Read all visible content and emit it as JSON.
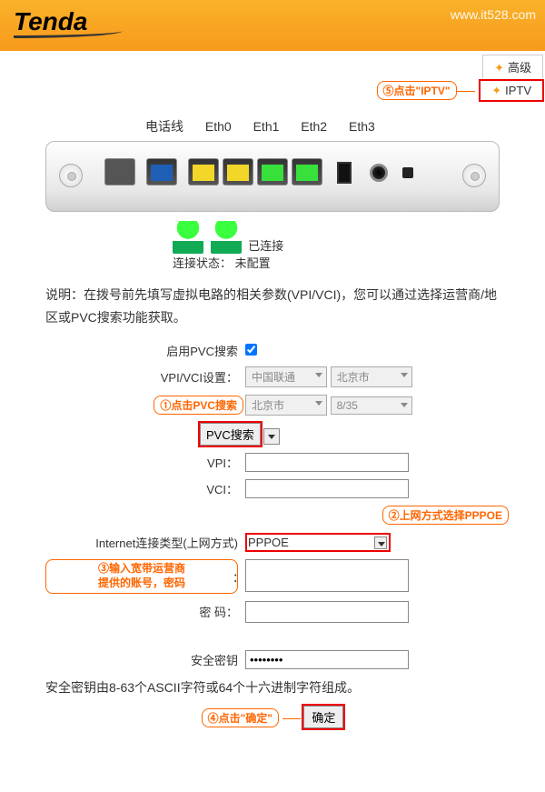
{
  "logo_text": "Tenda",
  "watermark": "www.it528.com",
  "tabs": {
    "advanced": "高级",
    "iptv": "IPTV"
  },
  "callouts": {
    "c1": "①点击PVC搜索",
    "c2": "②上网方式选择PPPOE",
    "c3_l1": "③输入宽带运营商",
    "c3_l2": "提供的账号，密码",
    "c4": "④点击\"确定\"",
    "c5": "⑤点击\"IPTV\""
  },
  "port_labels": [
    "电话线",
    "Eth0",
    "Eth1",
    "Eth2",
    "Eth3"
  ],
  "status": {
    "label": "连接状态：",
    "unconfigured": "未配置",
    "connected": "已连接"
  },
  "desc": "说明：在拨号前先填写虚拟电路的相关参数(VPI/VCI)，您可以通过选择运营商/地区或PVC搜索功能获取。",
  "pvc_enable_label": "启用PVC搜索",
  "vpivci_label": "VPI/VCI设置：",
  "isp_options": {
    "isp": "中国联通",
    "prov": "北京市",
    "city": "北京市",
    "pvc": "8/35"
  },
  "pvc_search_btn": "PVC搜索",
  "vpi_label": "VPI：",
  "vci_label": "VCI：",
  "conn_type_label": "Internet连接类型(上网方式)",
  "conn_type_value": "PPPOE",
  "account_suffix": "：",
  "password_label": "密  码：",
  "security_key_label": "安全密钥",
  "security_key_value": "••••••••",
  "key_hint": "安全密钥由8-63个ASCII字符或64个十六进制字符组成。",
  "submit": "确定"
}
